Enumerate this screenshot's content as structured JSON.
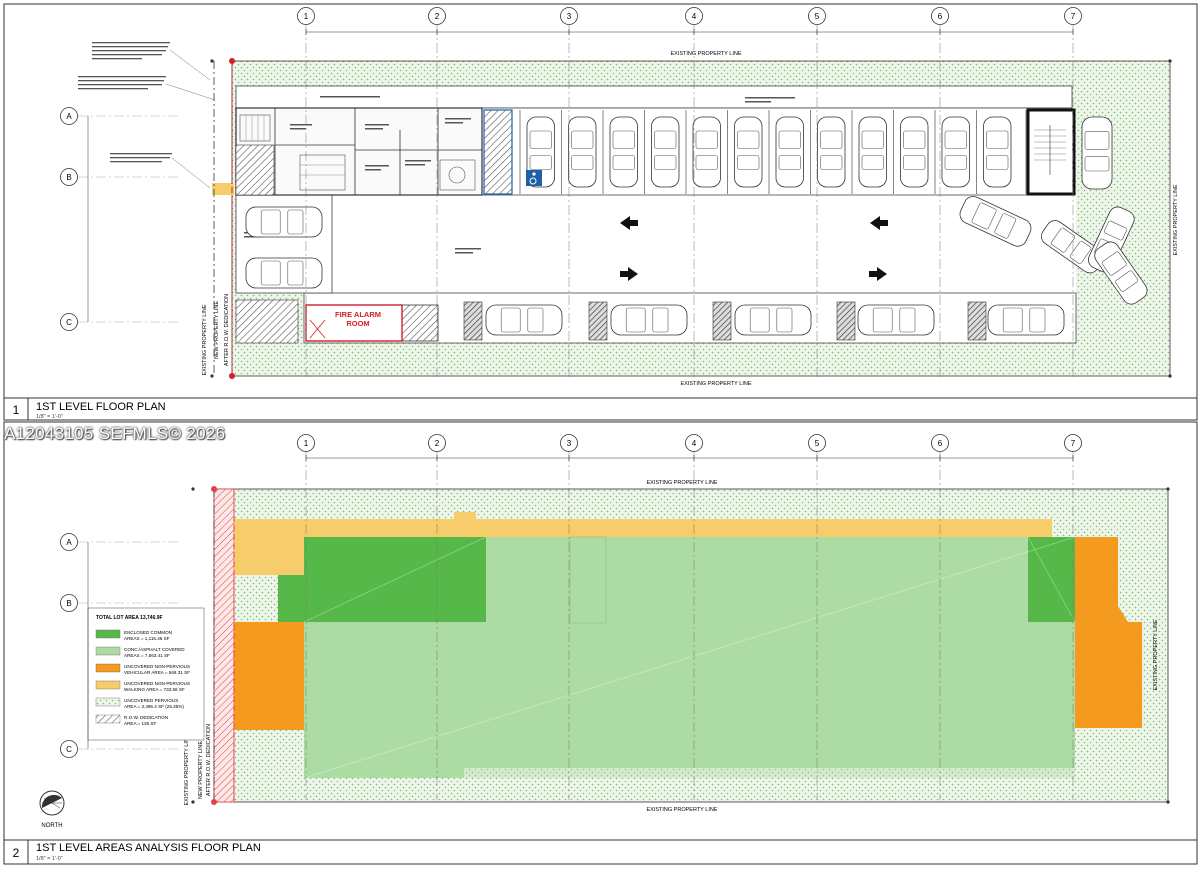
{
  "watermark": "A12043105  SEFMLS© 2026",
  "plan1": {
    "number": "1",
    "title": "1ST LEVEL FLOOR PLAN",
    "scale": "1/8\" = 1'-0\"",
    "gridlines": [
      "1",
      "2",
      "3",
      "4",
      "5",
      "6",
      "7"
    ],
    "rows": [
      "A",
      "B",
      "C"
    ],
    "property_line_top": "EXISTING PROPERTY LINE",
    "property_line_bottom": "EXISTING PROPERTY LINE",
    "property_line_right": "EXISTING PROPERTY LINE",
    "property_line_left": "EXISTING PROPERTY LINE",
    "new_property_line": "NEW PROPERTY LINE",
    "row_dedication": "AFTER R.O.W. DEDICATION",
    "fire_alarm_room": "FIRE ALARM\nROOM",
    "colors": {
      "landscape": "#e8f2e4",
      "dots": "#8fc28a",
      "fire": "#d0202a"
    }
  },
  "plan2": {
    "number": "2",
    "title": "1ST LEVEL AREAS ANALYSIS FLOOR PLAN",
    "scale": "1/8\" = 1'-0\"",
    "gridlines": [
      "1",
      "2",
      "3",
      "4",
      "5",
      "6",
      "7"
    ],
    "rows": [
      "A",
      "B",
      "C"
    ],
    "property_line_top": "EXISTING PROPERTY LINE",
    "property_line_bottom": "EXISTING PROPERTY LINE",
    "property_line_right": "EXISTING PROPERTY LINE",
    "property_line_left": "EXISTING PROPERTY LINE",
    "new_property_line": "NEW PROPERTY LINE",
    "row_dedication": "AFTER R.O.W. DEDICATION",
    "north_label": "NORTH",
    "legend": {
      "title": "TOTAL LOT AREA 13,746.9F",
      "items": [
        {
          "line1": "ENCLOSED COMMON",
          "line2": "AREAS = 1,115.46 SF",
          "color": "#56b848",
          "pattern": "solid"
        },
        {
          "line1": "CONC./ASPHALT COVERED",
          "line2": "AREAS = 7,563.41 SF",
          "color": "#acdba3",
          "pattern": "solid"
        },
        {
          "line1": "UNCOVERED NON-PERVIOUS",
          "line2": "VEHICULAR AREA = 566.31 SF",
          "color": "#f39a1f",
          "pattern": "solid"
        },
        {
          "line1": "UNCOVERED NON-PERVIOUS",
          "line2": "WALKING AREA = 733.56 SF",
          "color": "#f7cc6a",
          "pattern": "solid"
        },
        {
          "line1": "UNCOVERED PERVIOUS",
          "line2": "AREA = 3,495.4 SF (25.35%)",
          "color": "#eef6ea",
          "pattern": "dots"
        },
        {
          "line1": "R.O.W. DEDICATION",
          "line2": "AREA = 135 SF",
          "color": "#ffffff",
          "pattern": "hatch"
        }
      ]
    },
    "colors": {
      "enclosed": "#56b848",
      "covered": "#acdba3",
      "vehicular": "#f39a1f",
      "walking": "#f7cc6a",
      "pervious": "#eef6ea",
      "row": "#e0414a"
    }
  }
}
